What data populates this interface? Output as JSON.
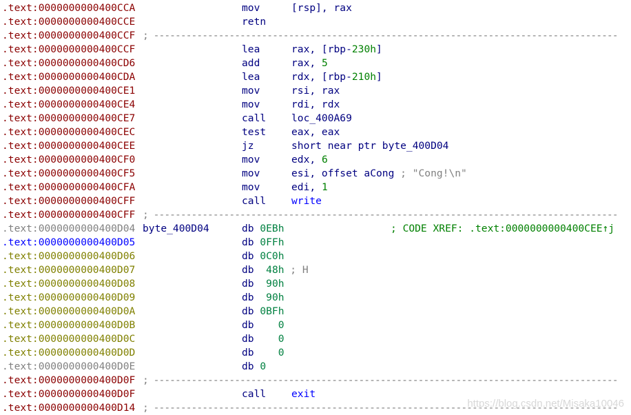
{
  "colors": {
    "addr_code": "#8b0000",
    "addr_data": "#808000",
    "addr_selected": "#0000ff",
    "addr_unexplored": "#808080",
    "mnemonic": "#000080",
    "number": "#008000",
    "name": "#0000ff",
    "comment": "#808080",
    "xref": "#008000"
  },
  "separator": "; --------------------------------------------------------------------------------------",
  "lines": [
    {
      "addr": ".text:0000000000400CCA",
      "ac": "red",
      "mn": "mov",
      "ops": [
        [
          "[rsp], rax",
          "reg"
        ]
      ]
    },
    {
      "addr": ".text:0000000000400CCE",
      "ac": "red",
      "mn": "retn",
      "ops": []
    },
    {
      "addr": ".text:0000000000400CCF",
      "ac": "red",
      "sep": true
    },
    {
      "addr": ".text:0000000000400CCF",
      "ac": "red",
      "mn": "lea",
      "ops": [
        [
          "rax, [rbp-",
          "reg"
        ],
        [
          "230h",
          "num"
        ],
        [
          "]",
          "reg"
        ]
      ]
    },
    {
      "addr": ".text:0000000000400CD6",
      "ac": "red",
      "mn": "add",
      "ops": [
        [
          "rax, ",
          "reg"
        ],
        [
          "5",
          "num"
        ]
      ]
    },
    {
      "addr": ".text:0000000000400CDA",
      "ac": "red",
      "mn": "lea",
      "ops": [
        [
          "rdx, [rbp-",
          "reg"
        ],
        [
          "210h",
          "num"
        ],
        [
          "]",
          "reg"
        ]
      ]
    },
    {
      "addr": ".text:0000000000400CE1",
      "ac": "red",
      "mn": "mov",
      "ops": [
        [
          "rsi, rax",
          "reg"
        ]
      ]
    },
    {
      "addr": ".text:0000000000400CE4",
      "ac": "red",
      "mn": "mov",
      "ops": [
        [
          "rdi, rdx",
          "reg"
        ]
      ]
    },
    {
      "addr": ".text:0000000000400CE7",
      "ac": "red",
      "mn": "call",
      "ops": [
        [
          "loc_400A69",
          "reg"
        ]
      ]
    },
    {
      "addr": ".text:0000000000400CEC",
      "ac": "red",
      "mn": "test",
      "ops": [
        [
          "eax, eax",
          "reg"
        ]
      ]
    },
    {
      "addr": ".text:0000000000400CEE",
      "ac": "red",
      "mn": "jz",
      "ops": [
        [
          "short near ptr byte_400D04",
          "reg"
        ]
      ]
    },
    {
      "addr": ".text:0000000000400CF0",
      "ac": "red",
      "mn": "mov",
      "ops": [
        [
          "edx, ",
          "reg"
        ],
        [
          "6",
          "num"
        ]
      ]
    },
    {
      "addr": ".text:0000000000400CF5",
      "ac": "red",
      "mn": "mov",
      "ops": [
        [
          "esi, offset aCong ",
          "reg"
        ],
        [
          "; \"Cong!\\n\"",
          "cmt"
        ]
      ]
    },
    {
      "addr": ".text:0000000000400CFA",
      "ac": "red",
      "mn": "mov",
      "ops": [
        [
          "edi, ",
          "reg"
        ],
        [
          "1",
          "num"
        ]
      ]
    },
    {
      "addr": ".text:0000000000400CFF",
      "ac": "red",
      "mn": "call",
      "ops": [
        [
          "write",
          "name"
        ]
      ]
    },
    {
      "addr": ".text:0000000000400CFF",
      "ac": "red",
      "sep": true
    },
    {
      "addr": ".text:0000000000400D04",
      "ac": "gray",
      "label": "byte_400D04",
      "db": [
        [
          "db ",
          "mn"
        ],
        [
          "0EBh",
          "dnum"
        ]
      ],
      "xref": "; CODE XREF: .text:0000000000400CEE↑j"
    },
    {
      "addr": ".text:0000000000400D05",
      "ac": "blue",
      "db": [
        [
          "db ",
          "mn"
        ],
        [
          "0FFh",
          "dnum"
        ]
      ]
    },
    {
      "addr": ".text:0000000000400D06",
      "ac": "olive",
      "db": [
        [
          "db ",
          "mn"
        ],
        [
          "0C0h",
          "dnum"
        ]
      ]
    },
    {
      "addr": ".text:0000000000400D07",
      "ac": "olive",
      "db": [
        [
          "db  ",
          "mn"
        ],
        [
          "48h",
          "dnum"
        ],
        [
          " ; H",
          "cmt"
        ]
      ]
    },
    {
      "addr": ".text:0000000000400D08",
      "ac": "olive",
      "db": [
        [
          "db  ",
          "mn"
        ],
        [
          "90h",
          "dnum"
        ]
      ]
    },
    {
      "addr": ".text:0000000000400D09",
      "ac": "olive",
      "db": [
        [
          "db  ",
          "mn"
        ],
        [
          "90h",
          "dnum"
        ]
      ]
    },
    {
      "addr": ".text:0000000000400D0A",
      "ac": "olive",
      "db": [
        [
          "db ",
          "mn"
        ],
        [
          "0BFh",
          "dnum"
        ]
      ]
    },
    {
      "addr": ".text:0000000000400D0B",
      "ac": "olive",
      "db": [
        [
          "db    ",
          "mn"
        ],
        [
          "0",
          "dnum"
        ]
      ]
    },
    {
      "addr": ".text:0000000000400D0C",
      "ac": "olive",
      "db": [
        [
          "db    ",
          "mn"
        ],
        [
          "0",
          "dnum"
        ]
      ]
    },
    {
      "addr": ".text:0000000000400D0D",
      "ac": "olive",
      "db": [
        [
          "db    ",
          "mn"
        ],
        [
          "0",
          "dnum"
        ]
      ]
    },
    {
      "addr": ".text:0000000000400D0E",
      "ac": "gray",
      "db": [
        [
          "db ",
          "mn"
        ],
        [
          "0",
          "dnum"
        ]
      ]
    },
    {
      "addr": ".text:0000000000400D0F",
      "ac": "red",
      "sep": true
    },
    {
      "addr": ".text:0000000000400D0F",
      "ac": "red",
      "mn": "call",
      "ops": [
        [
          "exit",
          "name"
        ]
      ]
    },
    {
      "addr": ".text:0000000000400D14",
      "ac": "red",
      "sep": true
    }
  ],
  "watermark": "https://blog.csdn.net/Misaka10046"
}
